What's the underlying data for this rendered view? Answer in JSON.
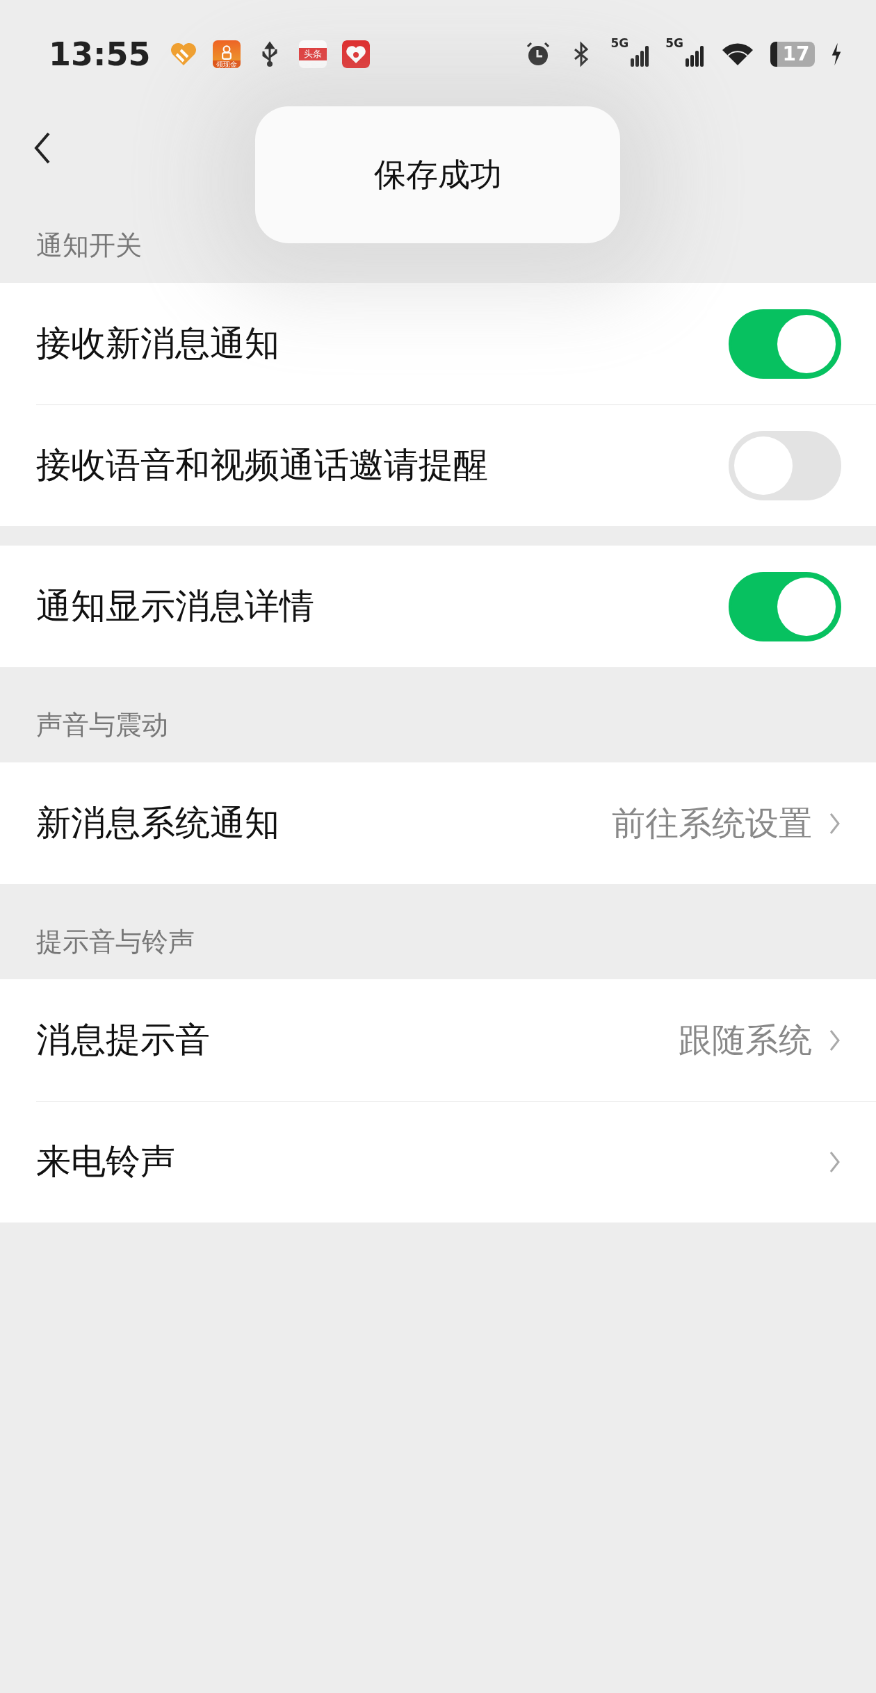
{
  "status_bar": {
    "time": "13:55",
    "notification_apps": [
      {
        "kind": "heart"
      },
      {
        "kind": "video",
        "label": "领现金"
      },
      {
        "kind": "usb"
      },
      {
        "kind": "news",
        "label": "头条"
      },
      {
        "kind": "shop"
      }
    ],
    "networks": [
      "5G",
      "5G"
    ],
    "battery": "17"
  },
  "toast": {
    "text": "保存成功"
  },
  "sections": [
    {
      "header": "通知开关",
      "groups": [
        [
          {
            "kind": "toggle",
            "label": "接收新消息通知",
            "on": true
          },
          {
            "kind": "toggle",
            "label": "接收语音和视频通话邀请提醒",
            "on": false
          }
        ],
        [
          {
            "kind": "toggle",
            "label": "通知显示消息详情",
            "on": true
          }
        ]
      ]
    },
    {
      "header": "声音与震动",
      "groups": [
        [
          {
            "kind": "link",
            "label": "新消息系统通知",
            "value": "前往系统设置"
          }
        ]
      ]
    },
    {
      "header": "提示音与铃声",
      "groups": [
        [
          {
            "kind": "link",
            "label": "消息提示音",
            "value": "跟随系统"
          },
          {
            "kind": "link",
            "label": "来电铃声"
          }
        ]
      ]
    }
  ]
}
